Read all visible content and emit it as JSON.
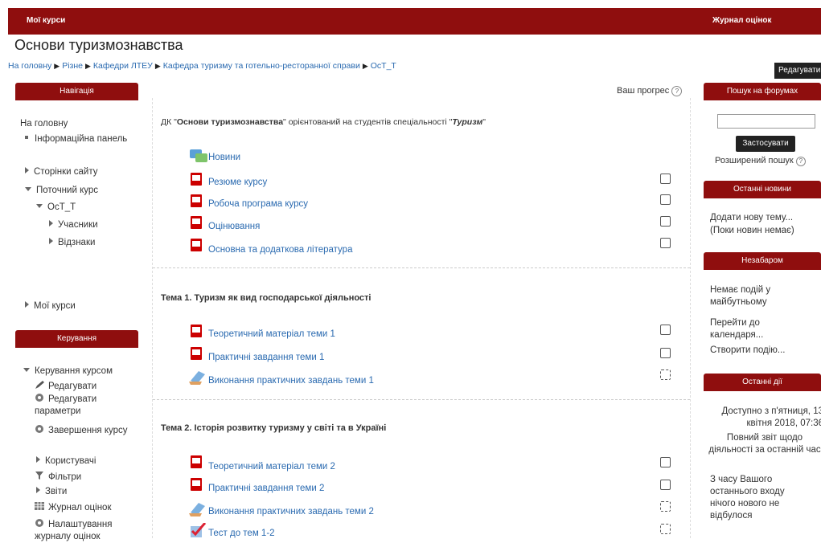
{
  "topbar": {
    "my_courses": "Мої курси",
    "gradebook": "Журнал оцінок"
  },
  "page_title": "Основи туризмознавства",
  "breadcrumb": [
    "На головну",
    "Різне",
    "Кафедри ЛТЕУ",
    "Кафедра туризму та готельно-ресторанної справи",
    "ОсТ_Т"
  ],
  "edit_button": "Редагувати",
  "nav": {
    "header": "Навігація",
    "home": "На головну",
    "dashboard": "Інформаційна панель",
    "site_pages": "Сторінки сайту",
    "current_course": "Поточний курс",
    "course": "ОсТ_Т",
    "participants": "Учасники",
    "badges": "Відзнаки",
    "my_courses": "Мої курси"
  },
  "admin": {
    "header": "Керування",
    "course_admin": "Керування курсом",
    "edit": "Редагувати",
    "edit_settings": "Редагувати параметри",
    "completion": "Завершення курсу",
    "users": "Користувачі",
    "filters": "Фільтри",
    "reports": "Звіти",
    "gradebook": "Журнал оцінок",
    "gradebook_setup": "Налаштування журналу оцінок"
  },
  "main": {
    "progress": "Ваш прогрес",
    "intro_prefix": "ДК \"",
    "intro_bold": "Основи туризмознавства",
    "intro_middle": "\" орієнтований на студентів спеціальності \"",
    "intro_italic": "Туризм",
    "intro_suffix": "\"",
    "section0": [
      "Новини",
      "Резюме курсу",
      "Робоча програма курсу",
      "Оцінювання",
      "Основна та додаткова література"
    ],
    "topic1_title": "Тема 1. Туризм як вид господарської діяльності",
    "topic1": [
      "Теоретичний матеріал теми 1",
      "Практичні завдання теми 1",
      "Виконання практичних завдань теми 1"
    ],
    "topic2_title": "Тема 2. Історія розвитку туризму у світі та в Україні",
    "topic2": [
      "Теоретичний матеріал теми 2",
      "Практичні завдання теми 2",
      "Виконання практичних завдань теми 2",
      "Тест до тем 1-2"
    ]
  },
  "right": {
    "search_header": "Пошук на форумах",
    "search_button": "Застосувати",
    "advanced_search": "Розширений пошук",
    "news_header": "Останні новини",
    "news_add": "Додати нову тему...",
    "news_none": "(Поки новин немає)",
    "upcoming_header": "Незабаром",
    "upcoming_none": "Немає подій у майбутньому",
    "goto_calendar": "Перейти до календаря...",
    "create_event": "Створити подію...",
    "recent_header": "Останні дії",
    "recent_since": "Доступно з п'ятниця, 13 квітня 2018, 07:36",
    "recent_report": "Повний звіт щодо діяльності за останній час",
    "recent_nothing": "З часу Вашого останнього входу нічого нового не відбулося"
  }
}
